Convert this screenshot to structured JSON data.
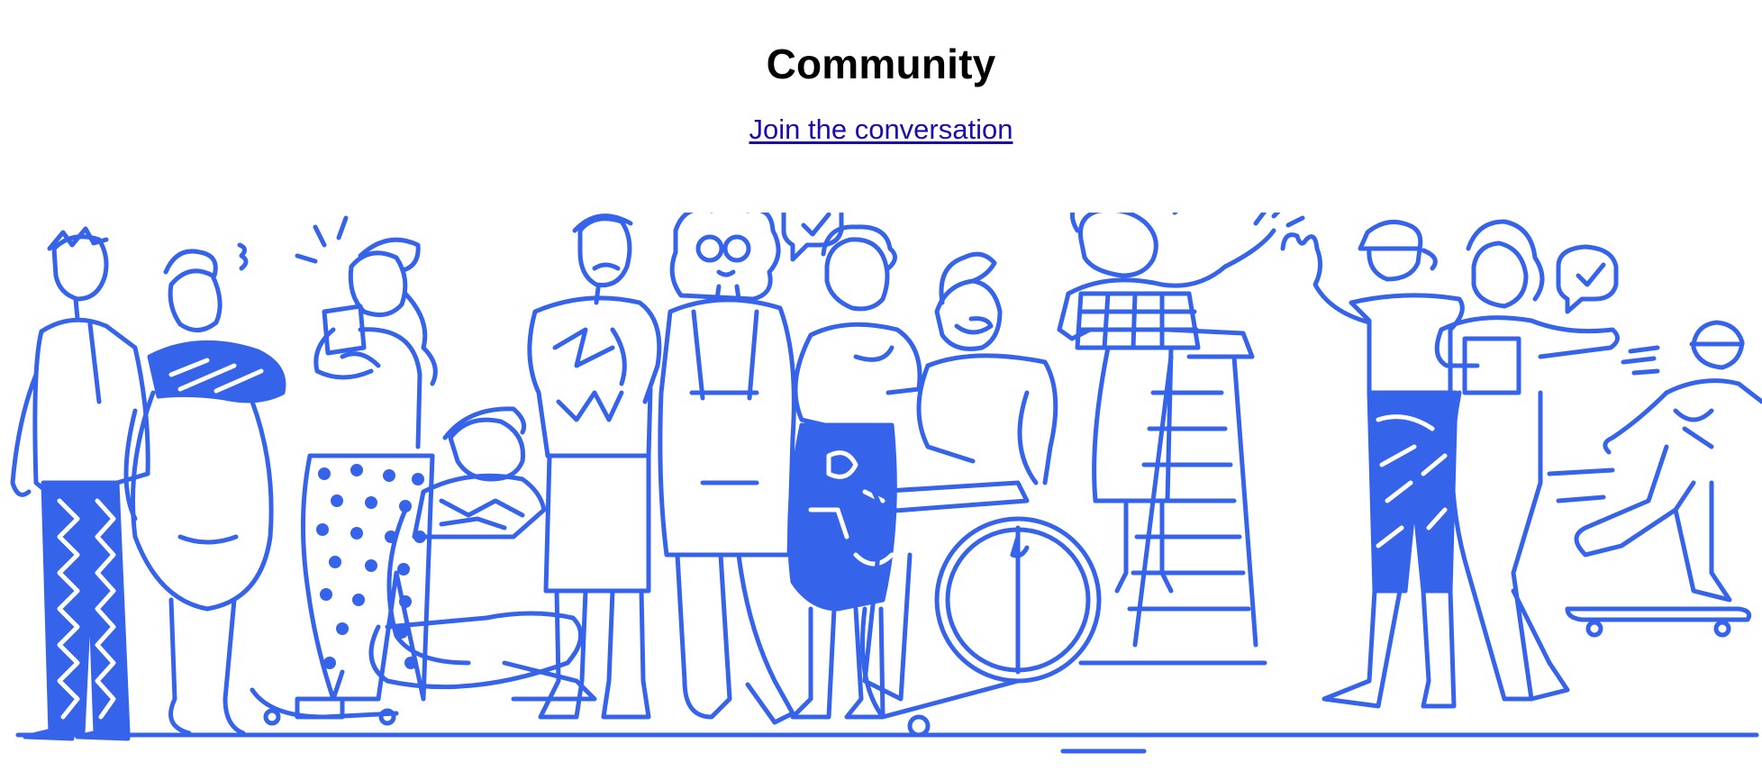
{
  "section": {
    "title": "Community",
    "link_label": "Join the conversation"
  },
  "illustration": {
    "icon": "people-community-illustration",
    "accent_color": "#3563e9"
  },
  "colors": {
    "link": "#1a0dab",
    "title": "#000000",
    "background": "#ffffff"
  }
}
